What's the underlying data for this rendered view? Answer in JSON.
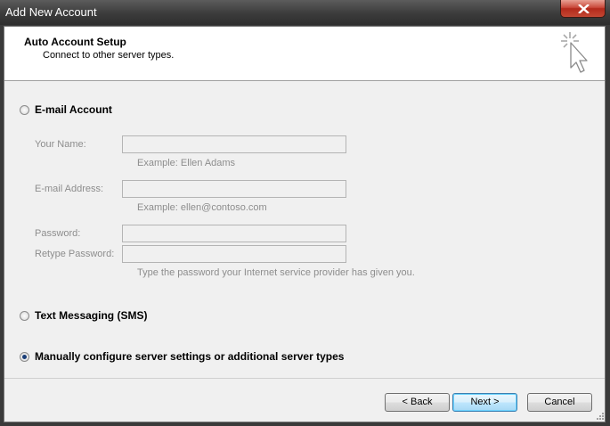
{
  "window": {
    "title": "Add New Account"
  },
  "header": {
    "title": "Auto Account Setup",
    "subtitle": "Connect to other server types."
  },
  "options": {
    "email": {
      "label": "E-mail Account",
      "selected": false,
      "fields": {
        "your_name": {
          "label": "Your Name:",
          "value": "",
          "example": "Example: Ellen Adams"
        },
        "email_address": {
          "label": "E-mail Address:",
          "value": "",
          "example": "Example: ellen@contoso.com"
        },
        "password": {
          "label": "Password:",
          "value": ""
        },
        "retype_password": {
          "label": "Retype Password:",
          "value": ""
        },
        "password_hint": "Type the password your Internet service provider has given you."
      }
    },
    "sms": {
      "label": "Text Messaging (SMS)",
      "selected": false
    },
    "manual": {
      "label": "Manually configure server settings or additional server types",
      "selected": true
    }
  },
  "buttons": {
    "back": "< Back",
    "next": "Next >",
    "cancel": "Cancel"
  },
  "icons": {
    "close": "close-icon",
    "wizard": "sparkle-cursor-icon",
    "grip": "resize-grip-icon"
  }
}
